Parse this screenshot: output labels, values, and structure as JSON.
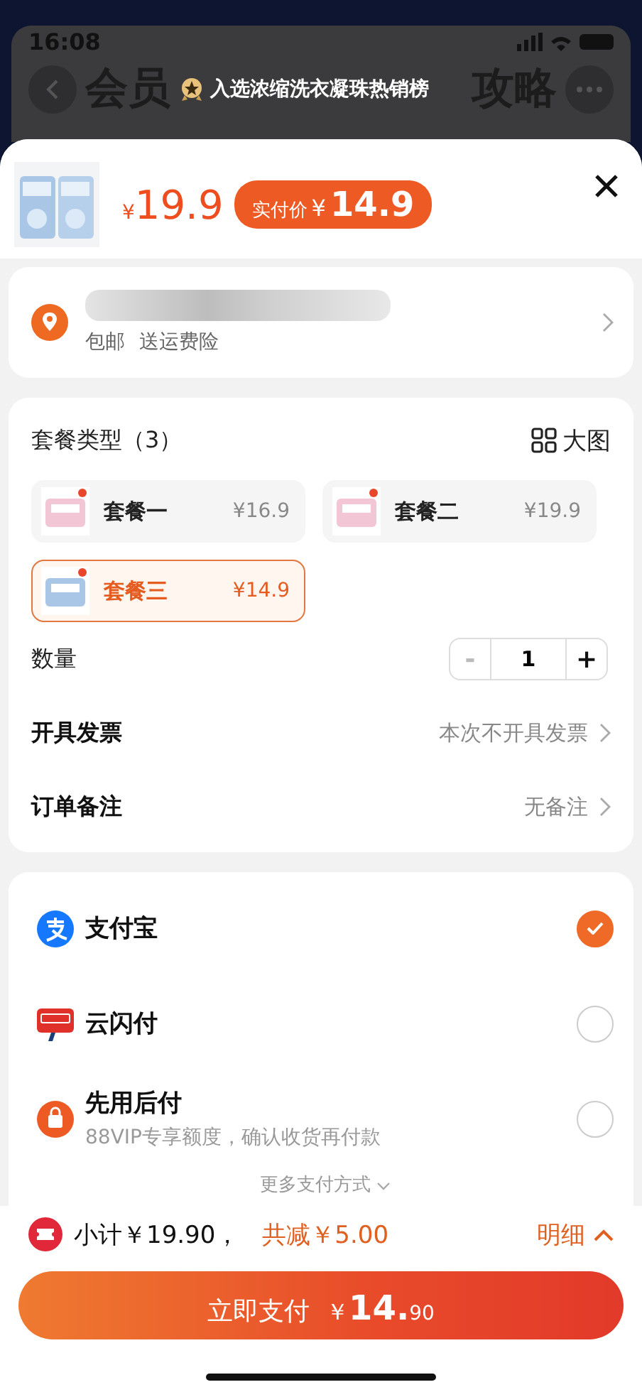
{
  "status_bar": {
    "time": "16:08"
  },
  "background_page": {
    "title_left": "会员",
    "title_right": "攻略"
  },
  "banner": {
    "text": "入选浓缩洗衣凝珠热销榜"
  },
  "product": {
    "price_symbol": "¥",
    "price": "19.9",
    "actual_label": "实付价",
    "actual_symbol": "¥",
    "actual_price": "14.9"
  },
  "address": {
    "tags": [
      "包邮",
      "送运费险"
    ]
  },
  "packages": {
    "title": "套餐类型（3）",
    "view_toggle": "大图",
    "items": [
      {
        "name": "套餐一",
        "price": "¥16.9",
        "selected": false
      },
      {
        "name": "套餐二",
        "price": "¥19.9",
        "selected": false
      },
      {
        "name": "套餐三",
        "price": "¥14.9",
        "selected": true
      }
    ]
  },
  "quantity": {
    "label": "数量",
    "minus": "-",
    "value": "1",
    "plus": "+",
    "minus_disabled": true
  },
  "options": [
    {
      "label": "开具发票",
      "value": "本次不开具发票"
    },
    {
      "label": "订单备注",
      "value": "无备注"
    }
  ],
  "payments": [
    {
      "kind": "alipay",
      "name": "支付宝",
      "selected": true
    },
    {
      "kind": "unionpay",
      "name": "云闪付",
      "selected": false
    },
    {
      "kind": "paylater",
      "name": "先用后付",
      "note": "88VIP专享额度，确认收货再付款",
      "selected": false
    }
  ],
  "more_payments": "更多支付方式",
  "summary": {
    "subtotal": "小计￥19.90，",
    "discount": "共减￥5.00",
    "details": "明细"
  },
  "pay_button": {
    "label": "立即支付",
    "symbol": "￥",
    "amount": "14.",
    "cents": "90"
  }
}
